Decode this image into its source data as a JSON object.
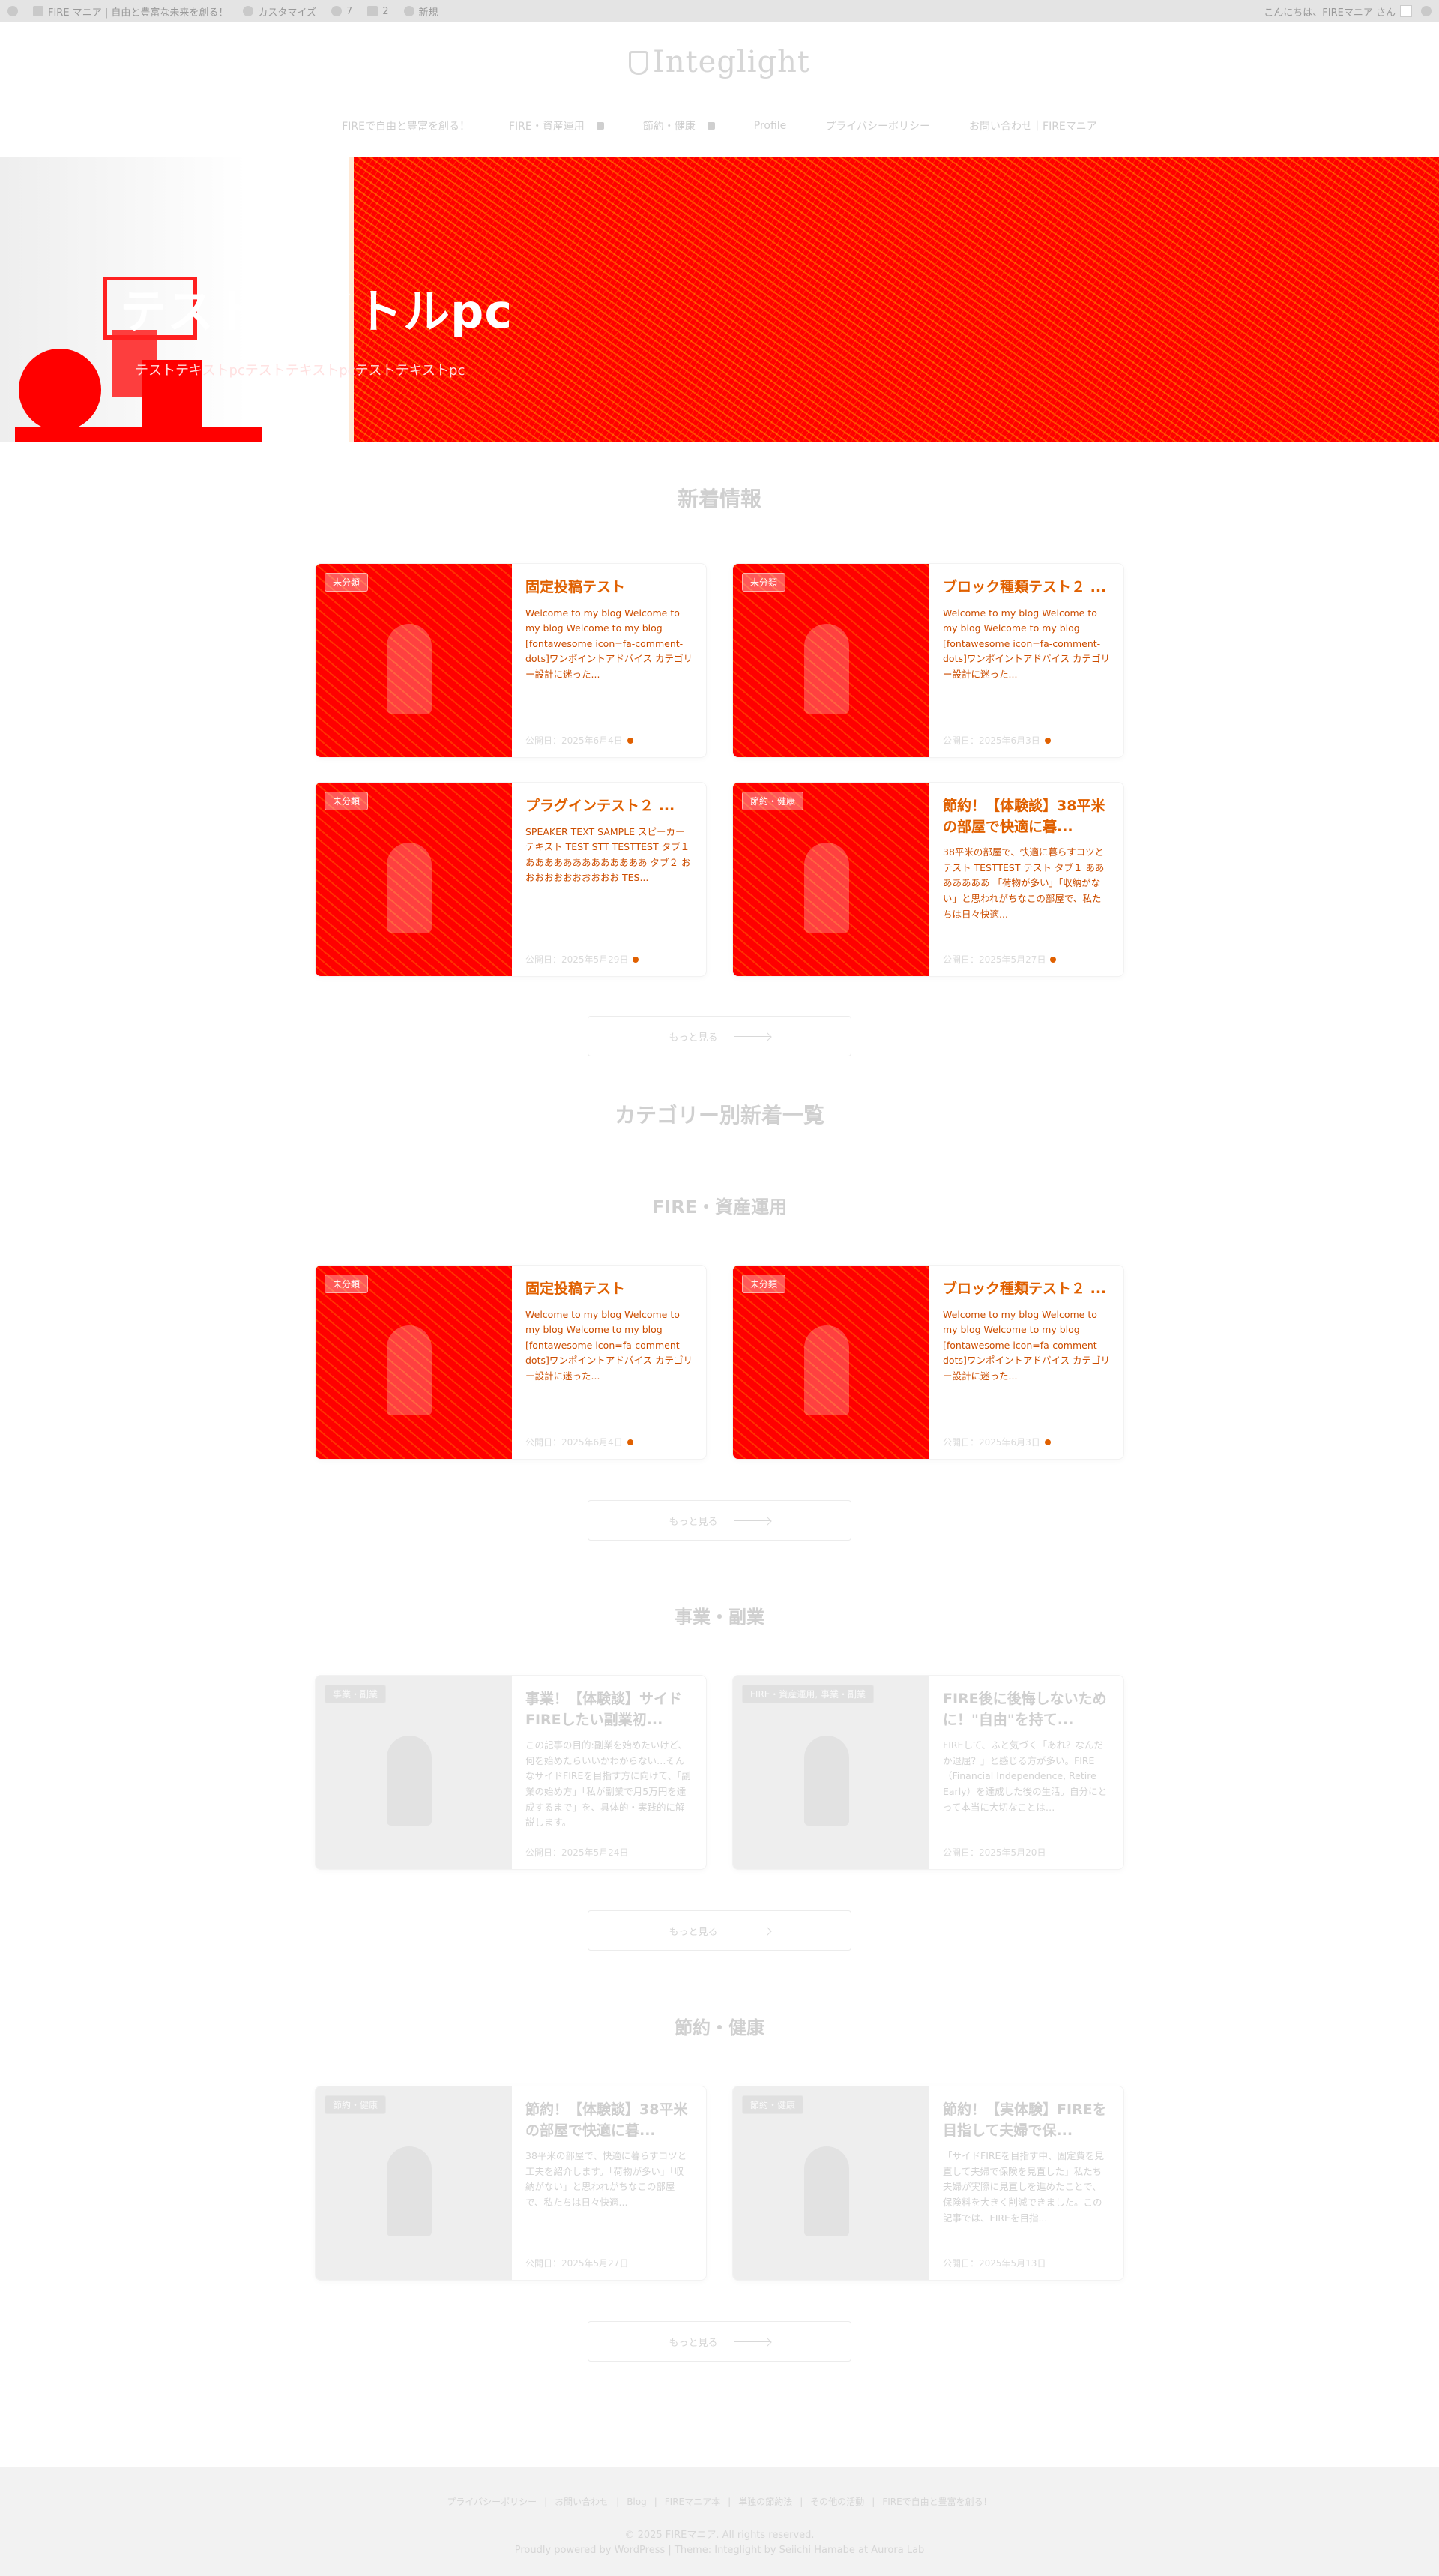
{
  "adminbar": {
    "site_name": "FIRE マニア | 自由と豊富な未来を創る！",
    "customize": "カスタマイズ",
    "updates": "7",
    "comments": "2",
    "new": "新規",
    "greeting": "こんにちは、FIREマニア さん"
  },
  "header": {
    "logo": "Integlight",
    "nav": [
      {
        "label": "FIREで自由と豊富を創る！"
      },
      {
        "label": "FIRE・資産運用"
      },
      {
        "label": "節約・健康"
      },
      {
        "label": "Profile"
      },
      {
        "label": "プライバシーポリシー"
      },
      {
        "label": "お問い合わせ｜FIREマニア"
      }
    ]
  },
  "hero": {
    "title": "テストタイトルpc",
    "subtitle": "テストテキストpcテストテキストpcテストテキストpc"
  },
  "sections": {
    "latest": "新着情報",
    "by_category": "カテゴリー別新着一覧",
    "fire": "FIRE・資産運用",
    "business": "事業・副業",
    "saving": "節約・健康",
    "more_label": "もっと見る"
  },
  "latest_posts": [
    {
      "category": "未分類",
      "title": "固定投稿テスト",
      "excerpt": "Welcome to my blog Welcome to my blog Welcome to my blog [fontawesome icon=fa-comment-dots]ワンポイントアドバイス カテゴリー設計に迷った...",
      "date": "公開日：2025年6月4日"
    },
    {
      "category": "未分類",
      "title": "ブロック種類テスト２ ...",
      "excerpt": "Welcome to my blog Welcome to my blog Welcome to my blog [fontawesome icon=fa-comment-dots]ワンポイントアドバイス カテゴリー設計に迷った...",
      "date": "公開日：2025年6月3日"
    },
    {
      "category": "未分類",
      "title": "プラグインテスト２ ...",
      "excerpt": "SPEAKER TEXT SAMPLE スピーカーテキスト TEST STT TESTTEST タブ１ あああああああああああああ タブ２ おおおおおおおおおおお TES...",
      "date": "公開日：2025年5月29日"
    },
    {
      "category": "節約・健康",
      "title": "節約！【体験談】38平米の部屋で快適に暮...",
      "excerpt": "38平米の部屋で、快適に暮らすコツとテスト TESTTEST テスト タブ１ あああああああ 「荷物が多い」「収納がない」と思われがちなこの部屋で、私たちは日々快適...",
      "date": "公開日：2025年5月27日"
    }
  ],
  "fire_posts": [
    {
      "category": "未分類",
      "title": "固定投稿テスト",
      "excerpt": "Welcome to my blog Welcome to my blog Welcome to my blog [fontawesome icon=fa-comment-dots]ワンポイントアドバイス カテゴリー設計に迷った...",
      "date": "公開日：2025年6月4日"
    },
    {
      "category": "未分類",
      "title": "ブロック種類テスト２ ...",
      "excerpt": "Welcome to my blog Welcome to my blog Welcome to my blog [fontawesome icon=fa-comment-dots]ワンポイントアドバイス カテゴリー設計に迷った...",
      "date": "公開日：2025年6月3日"
    }
  ],
  "business_posts": [
    {
      "category": "事業・副業",
      "title": "事業！【体験談】サイドFIREしたい副業初...",
      "excerpt": "この記事の目的:副業を始めたいけど、何を始めたらいいかわからない…そんなサイドFIREを目指す方に向けて、「副業の始め方」「私が副業で月5万円を達成するまで」を、具体的・実践的に解説します。",
      "date": "公開日：2025年5月24日"
    },
    {
      "category": "FIRE・資産運用, 事業・副業",
      "title": "FIRE後に後悔しないために！\"自由\"を持て...",
      "excerpt": "FIREして、ふと気づく「あれ？なんだか退屈？」と感じる方が多い。FIRE（Financial Independence, Retire Early）を達成した後の生活。自分にとって本当に大切なことは…",
      "date": "公開日：2025年5月20日"
    }
  ],
  "saving_posts": [
    {
      "category": "節約・健康",
      "title": "節約！【体験談】38平米の部屋で快適に暮...",
      "excerpt": "38平米の部屋で、快適に暮らすコツと工夫を紹介します。「荷物が多い」「収納がない」と思われがちなこの部屋で、私たちは日々快適...",
      "date": "公開日：2025年5月27日"
    },
    {
      "category": "節約・健康",
      "title": "節約！【実体験】FIREを目指して夫婦で保...",
      "excerpt": "「サイドFIREを目指す中、固定費を見直して夫婦で保険を見直した」私たち夫婦が実際に見直しを進めたことで、保険料を大きく削減できました。この記事では、FIREを目指...",
      "date": "公開日：2025年5月13日"
    }
  ],
  "footer": {
    "links": [
      "プライバシーポリシー",
      "お問い合わせ",
      "Blog",
      "FIREマニア本",
      "単独の節約法",
      "その他の活動",
      "FIREで自由と豊富を創る！"
    ],
    "copyright": "© 2025 FIREマニア. All rights reserved.",
    "powered": "Proudly powered by WordPress | Theme: Integlight by Seiichi Hamabe at Aurora Lab"
  }
}
